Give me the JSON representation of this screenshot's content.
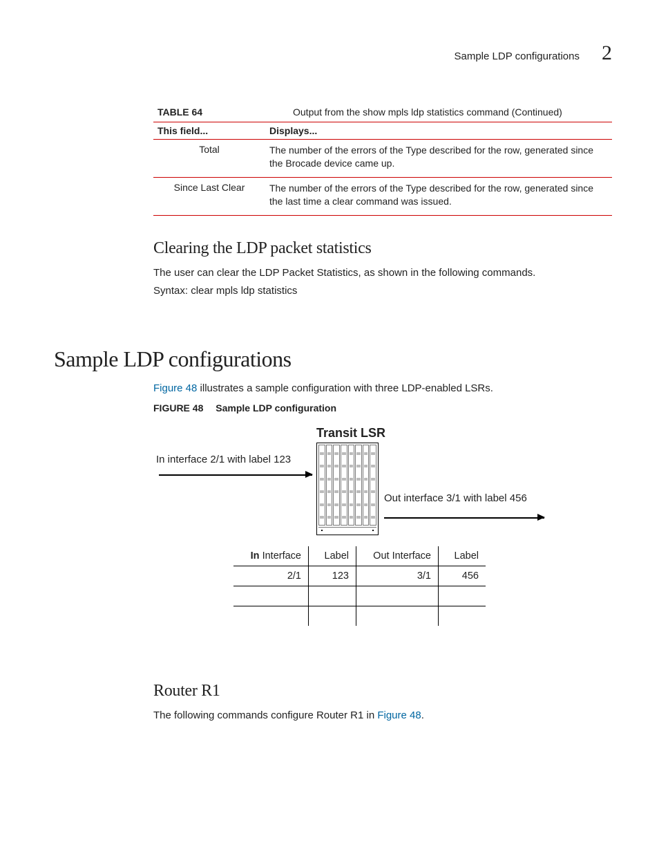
{
  "runningHead": {
    "title": "Sample LDP configurations",
    "chapter": "2"
  },
  "table64": {
    "num": "TABLE 64",
    "caption": "Output from the show mpls ldp statistics command  (Continued)",
    "head": {
      "c1": "This field...",
      "c2": "Displays..."
    },
    "rows": [
      {
        "c1": "Total",
        "c2": "The number of the errors of the Type described for the row, generated since the Brocade device came up."
      },
      {
        "c1": "Since Last Clear",
        "c2": "The number of the errors of the Type described for the row, generated since the last time a clear command was issued."
      }
    ]
  },
  "sub1": {
    "heading": "Clearing the LDP packet statistics",
    "body": "The user can clear the LDP Packet Statistics, as shown in the following commands.",
    "syntax": "Syntax:  clear mpls ldp statistics"
  },
  "sec2": {
    "heading": "Sample LDP configurations",
    "intro_a": "Figure 48",
    "intro_b": " illustrates a sample configuration with three LDP-enabled LSRs.",
    "fig": {
      "num": "FIGURE 48",
      "title": "Sample LDP configuration",
      "transit": "Transit LSR",
      "inlabel": "In interface 2/1 with label 123",
      "outlabel": "Out interface 3/1 with label 456",
      "thead": {
        "in": "In Interface",
        "l1": "Label",
        "out": "Out Interface",
        "l2": "Label"
      },
      "trow": {
        "in": "2/1",
        "l1": "123",
        "out": "3/1",
        "l2": "456"
      }
    },
    "r1_head": "Router R1",
    "r1_a": "The following commands configure Router R1 in ",
    "r1_link": "Figure 48",
    "r1_b": "."
  },
  "chart_data": {
    "type": "table",
    "title": "Transit LSR label table",
    "columns": [
      "In Interface",
      "Label",
      "Out Interface",
      "Label"
    ],
    "rows": [
      [
        "2/1",
        123,
        "3/1",
        456
      ]
    ]
  }
}
